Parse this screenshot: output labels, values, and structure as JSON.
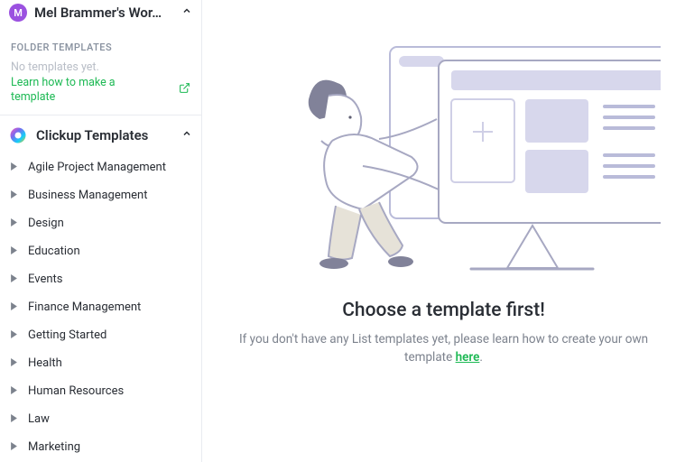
{
  "workspace": {
    "avatar_initial": "M",
    "name": "Mel Brammer's Wor…"
  },
  "folder_templates": {
    "section_label": "FOLDER TEMPLATES",
    "empty_text": "No templates yet.",
    "learn_link": "Learn how to make a template"
  },
  "clickup_templates": {
    "title": "Clickup Templates",
    "categories": [
      "Agile Project Management",
      "Business Management",
      "Design",
      "Education",
      "Events",
      "Finance Management",
      "Getting Started",
      "Health",
      "Human Resources",
      "Law",
      "Marketing"
    ]
  },
  "main": {
    "headline": "Choose a template first!",
    "sub_prefix": "If you don't have any List templates yet, please learn how to create your own template ",
    "here_label": "here",
    "sub_suffix": "."
  }
}
